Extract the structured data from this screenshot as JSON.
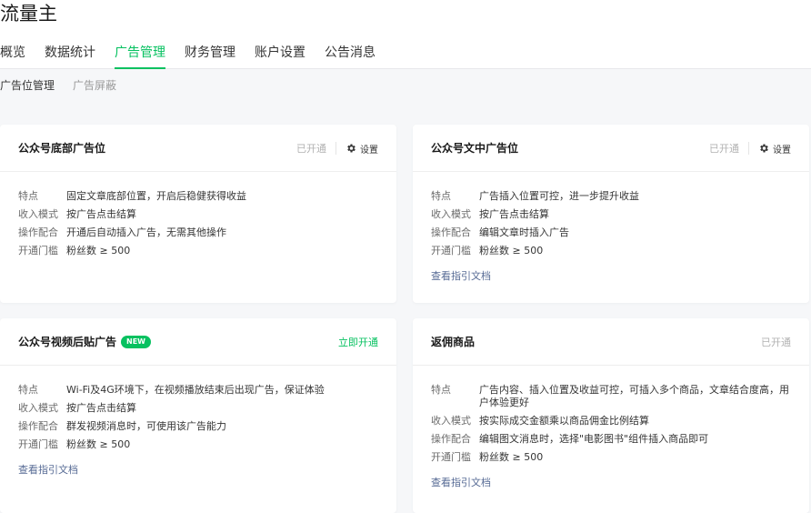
{
  "app": {
    "title": "流量主"
  },
  "nav": {
    "items": [
      {
        "label": "概览"
      },
      {
        "label": "数据统计"
      },
      {
        "label": "广告管理"
      },
      {
        "label": "财务管理"
      },
      {
        "label": "账户设置"
      },
      {
        "label": "公告消息"
      }
    ],
    "active_index": 2
  },
  "subnav": {
    "items": [
      {
        "label": "广告位管理"
      },
      {
        "label": "广告屏蔽"
      }
    ],
    "active_index": 0
  },
  "colors": {
    "accent": "#07c160",
    "link": "#576b95",
    "muted": "#b2b2b2"
  },
  "cards": [
    {
      "title": "公众号底部广告位",
      "status": "已开通",
      "settings_label": "设置",
      "rows": [
        {
          "label": "特点",
          "value": "固定文章底部位置，开启后稳健获得收益"
        },
        {
          "label": "收入模式",
          "value": "按广告点击结算"
        },
        {
          "label": "操作配合",
          "value": "开通后自动插入广告，无需其他操作"
        },
        {
          "label": "开通门槛",
          "value": "粉丝数 ≥ 500"
        }
      ]
    },
    {
      "title": "公众号文中广告位",
      "status": "已开通",
      "settings_label": "设置",
      "rows": [
        {
          "label": "特点",
          "value": "广告插入位置可控，进一步提升收益"
        },
        {
          "label": "收入模式",
          "value": "按广告点击结算"
        },
        {
          "label": "操作配合",
          "value": "编辑文章时插入广告"
        },
        {
          "label": "开通门槛",
          "value": "粉丝数 ≥ 500"
        }
      ],
      "doc_link": "查看指引文档"
    },
    {
      "title": "公众号视频后贴广告",
      "badge": "NEW",
      "action": "立即开通",
      "rows": [
        {
          "label": "特点",
          "value": "Wi-Fi及4G环境下，在视频播放结束后出现广告，保证体验"
        },
        {
          "label": "收入模式",
          "value": "按广告点击结算"
        },
        {
          "label": "操作配合",
          "value": "群发视频消息时，可使用该广告能力"
        },
        {
          "label": "开通门槛",
          "value": "粉丝数 ≥ 500"
        }
      ],
      "doc_link": "查看指引文档"
    },
    {
      "title": "返佣商品",
      "status": "已开通",
      "rows": [
        {
          "label": "特点",
          "value": "广告内容、插入位置及收益可控，可插入多个商品，文章结合度高，用户体验更好"
        },
        {
          "label": "收入模式",
          "value": "按实际成交金额乘以商品佣金比例结算"
        },
        {
          "label": "操作配合",
          "value": "编辑图文消息时，选择\"电影图书\"组件插入商品即可"
        },
        {
          "label": "开通门槛",
          "value": "粉丝数 ≥ 500"
        }
      ],
      "doc_link": "查看指引文档"
    }
  ]
}
